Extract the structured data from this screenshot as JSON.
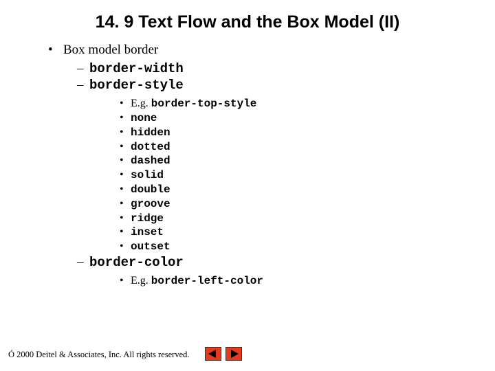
{
  "title": "14. 9 Text Flow and the Box Model (II)",
  "l1": {
    "text": "Box model border"
  },
  "l2a": "border-width",
  "l2b": "border-style",
  "l2b_items": {
    "eg_prefix": "E.g. ",
    "eg_code": "border-top-style",
    "i1": "none",
    "i2": "hidden",
    "i3": "dotted",
    "i4": "dashed",
    "i5": "solid",
    "i6": "double",
    "i7": "groove",
    "i8": "ridge",
    "i9": "inset",
    "i10": "outset"
  },
  "l2c": "border-color",
  "l2c_items": {
    "eg_prefix": "E.g. ",
    "eg_code": "border-left-color"
  },
  "footer": "Ó 2000 Deitel & Associates, Inc.  All rights reserved."
}
